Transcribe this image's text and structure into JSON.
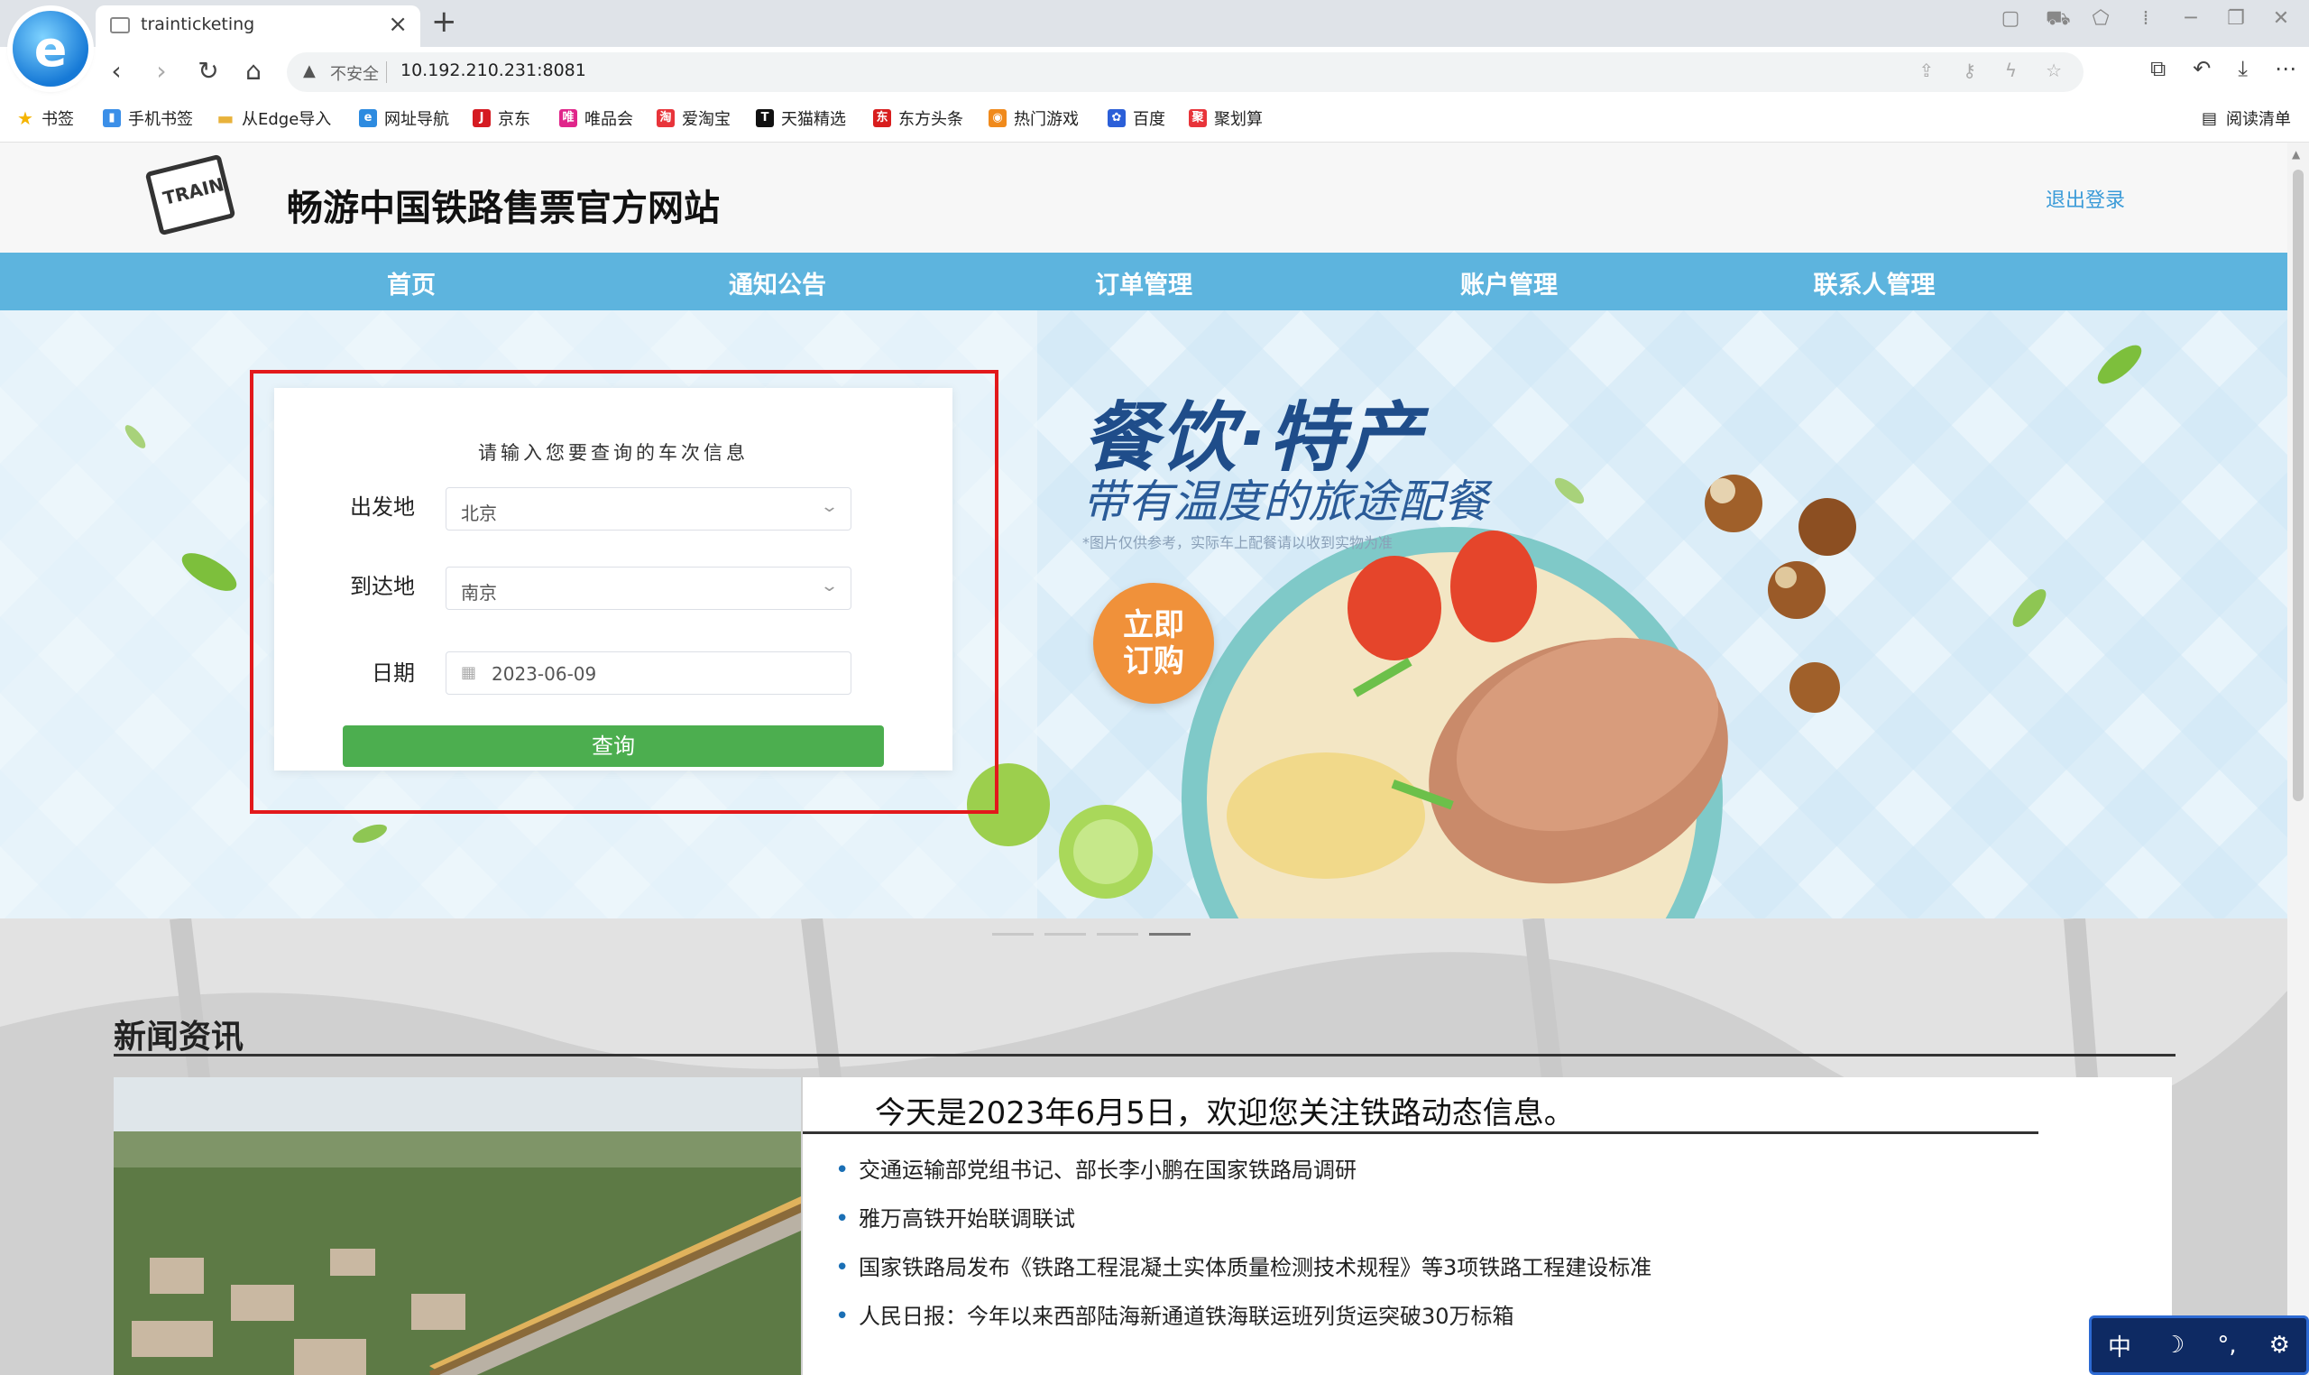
{
  "browser": {
    "tab_title": "trainticketing",
    "new_tab": "+",
    "close": "×",
    "url_insecure_label": "不安全",
    "url": "10.192.210.231:8081",
    "bookmarks": [
      {
        "label": "书签",
        "icon": "star-icon",
        "color": "#f5b400"
      },
      {
        "label": "手机书签",
        "icon": "phone-icon",
        "color": "#3b8fe8"
      },
      {
        "label": "从Edge导入",
        "icon": "folder-icon",
        "color": "#e8b23b"
      },
      {
        "label": "网址导航",
        "icon": "e-icon",
        "color": "#2d8be0"
      },
      {
        "label": "京东",
        "icon": "jd-icon",
        "color": "#d51b22"
      },
      {
        "label": "唯品会",
        "icon": "vip-icon",
        "color": "#e0258a"
      },
      {
        "label": "爱淘宝",
        "icon": "taobao-icon",
        "color": "#e8343a"
      },
      {
        "label": "天猫精选",
        "icon": "tmall-icon",
        "color": "#111111"
      },
      {
        "label": "东方头条",
        "icon": "toutiao-icon",
        "color": "#d81e1e"
      },
      {
        "label": "热门游戏",
        "icon": "game-icon",
        "color": "#f08a1c"
      },
      {
        "label": "百度",
        "icon": "baidu-icon",
        "color": "#2b5fd8"
      },
      {
        "label": "聚划算",
        "icon": "juhuasuan-icon",
        "color": "#e8343a"
      }
    ],
    "reading_list": "阅读清单"
  },
  "site": {
    "logo_text": "TRAIN",
    "title": "畅游中国铁路售票官方网站",
    "logout": "退出登录",
    "nav": [
      "首页",
      "通知公告",
      "订单管理",
      "账户管理",
      "联系人管理"
    ]
  },
  "banner": {
    "promo_title": "餐饮·特产",
    "promo_sub": "带有温度的旅途配餐",
    "promo_note": "*图片仅供参考，实际车上配餐请以收到实物为准",
    "order_badge": "立即\n订购"
  },
  "query": {
    "title": "请输入您要查询的车次信息",
    "from_label": "出发地",
    "from_value": "北京",
    "to_label": "到达地",
    "to_value": "南京",
    "date_label": "日期",
    "date_value": "2023-06-09",
    "submit": "查询"
  },
  "news": {
    "heading": "新闻资讯",
    "welcome": "今天是2023年6月5日，欢迎您关注铁路动态信息。",
    "items": [
      "交通运输部党组书记、部长李小鹏在国家铁路局调研",
      "雅万高铁开始联调联试",
      "国家铁路局发布《铁路工程混凝土实体质量检测技术规程》等3项铁路工程建设标准",
      "人民日报：今年以来西部陆海新通道铁海联运班列货运突破30万标箱"
    ]
  },
  "ime_bar": [
    "中",
    "☽",
    "°,",
    "⚙"
  ]
}
